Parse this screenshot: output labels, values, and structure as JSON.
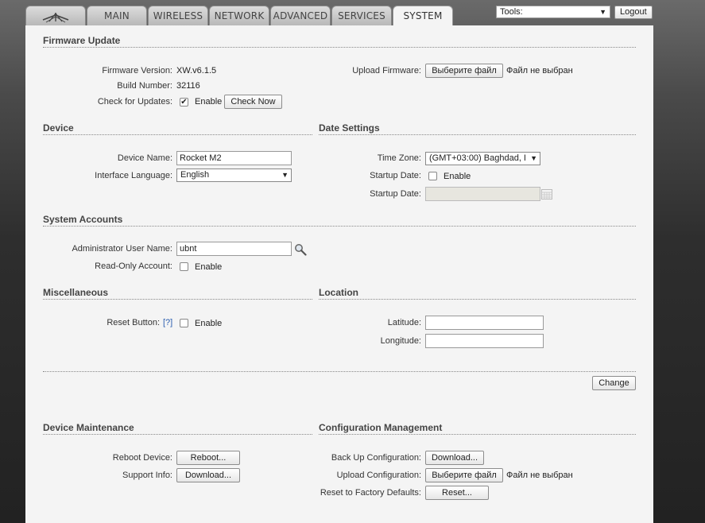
{
  "tabs": [
    {
      "label": "MAIN"
    },
    {
      "label": "WIRELESS"
    },
    {
      "label": "NETWORK"
    },
    {
      "label": "ADVANCED"
    },
    {
      "label": "SERVICES"
    },
    {
      "label": "SYSTEM"
    }
  ],
  "active_tab": "SYSTEM",
  "topbar": {
    "tools_label": "Tools:",
    "logout_label": "Logout"
  },
  "firmware": {
    "title": "Firmware Update",
    "version_label": "Firmware Version:",
    "version": "XW.v6.1.5",
    "build_label": "Build Number:",
    "build": "32116",
    "check_label": "Check for Updates:",
    "check_enable": "Enable",
    "check_checked": true,
    "check_now": "Check Now",
    "upload_label": "Upload Firmware:",
    "choose_file": "Выберите файл",
    "no_file": "Файл не выбран"
  },
  "device": {
    "title": "Device",
    "name_label": "Device Name:",
    "name_value": "Rocket M2",
    "lang_label": "Interface Language:",
    "lang_value": "English"
  },
  "date": {
    "title": "Date Settings",
    "tz_label": "Time Zone:",
    "tz_value": "(GMT+03:00) Baghdad, I",
    "startup_label": "Startup Date:",
    "startup_enable": "Enable",
    "startup_date_label": "Startup Date:"
  },
  "accounts": {
    "title": "System Accounts",
    "admin_label": "Administrator User Name:",
    "admin_value": "ubnt",
    "readonly_label": "Read-Only Account:",
    "readonly_enable": "Enable"
  },
  "misc": {
    "title": "Miscellaneous",
    "reset_label": "Reset Button:",
    "help": "[?]",
    "reset_enable": "Enable"
  },
  "location": {
    "title": "Location",
    "lat_label": "Latitude:",
    "lon_label": "Longitude:"
  },
  "change_label": "Change",
  "maintenance": {
    "title": "Device Maintenance",
    "reboot_label": "Reboot Device:",
    "reboot_btn": "Reboot...",
    "support_label": "Support Info:",
    "support_btn": "Download..."
  },
  "config": {
    "title": "Configuration Management",
    "backup_label": "Back Up Configuration:",
    "backup_btn": "Download...",
    "upload_label": "Upload Configuration:",
    "choose_file": "Выберите файл",
    "no_file": "Файл не выбран",
    "reset_label": "Reset to Factory Defaults:",
    "reset_btn": "Reset..."
  }
}
